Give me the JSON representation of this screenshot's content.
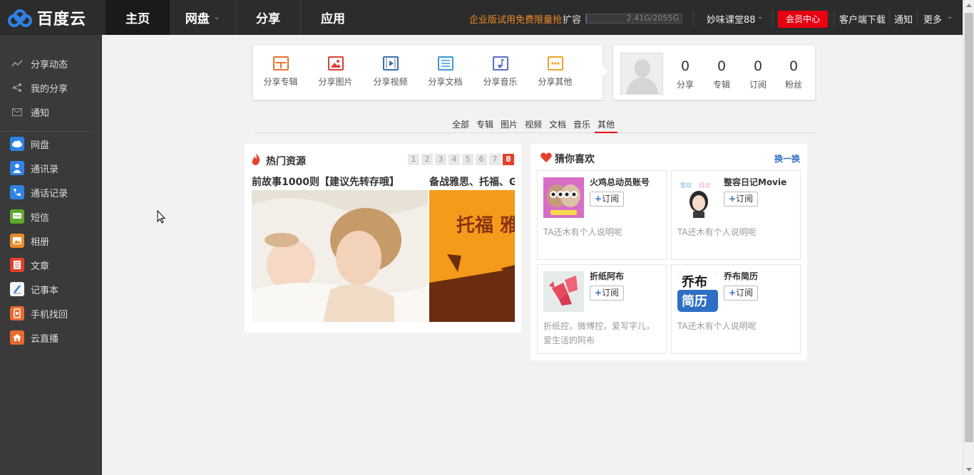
{
  "logo": {
    "text": "百度云",
    "brand_color": "#2e83e6"
  },
  "top_nav": [
    {
      "label": "主页",
      "active": true,
      "has_dropdown": false
    },
    {
      "label": "网盘",
      "active": false,
      "has_dropdown": true
    },
    {
      "label": "分享",
      "active": false,
      "has_dropdown": false
    },
    {
      "label": "应用",
      "active": false,
      "has_dropdown": false
    }
  ],
  "topbar": {
    "trial_text": "企业版试用免费限量抢",
    "expand_text": "扩容",
    "quota_text": "2.41G/2055G",
    "quota_used_fraction": 0.0012,
    "username": "妙味课堂88",
    "vip_button": "会员中心",
    "client_download": "客户端下载",
    "notify": "通知",
    "more": "更多",
    "accent_color": "#f08a24",
    "vip_color": "#e60012"
  },
  "sidebar": {
    "group1": [
      {
        "label": "分享动态",
        "icon": "activity-icon"
      },
      {
        "label": "我的分享",
        "icon": "share-icon"
      },
      {
        "label": "通知",
        "icon": "mail-icon"
      }
    ],
    "group2": [
      {
        "label": "网盘",
        "icon": "cloud-drive-icon",
        "color": "#2e83e6"
      },
      {
        "label": "通讯录",
        "icon": "contacts-icon",
        "color": "#2e83e6"
      },
      {
        "label": "通话记录",
        "icon": "call-log-icon",
        "color": "#2e83e6"
      },
      {
        "label": "短信",
        "icon": "sms-icon",
        "color": "#5fa92d"
      },
      {
        "label": "相册",
        "icon": "album-icon",
        "color": "#e88a2a"
      },
      {
        "label": "文章",
        "icon": "article-icon",
        "color": "#e3412c"
      },
      {
        "label": "记事本",
        "icon": "notepad-icon",
        "color": "#3a7bd5"
      },
      {
        "label": "手机找回",
        "icon": "phone-find-icon",
        "color": "#e96b2d"
      },
      {
        "label": "云直播",
        "icon": "live-icon",
        "color": "#e96b2d"
      }
    ]
  },
  "share_panel": [
    {
      "label": "分享专辑",
      "icon": "album-share-icon",
      "color": "#e8742a"
    },
    {
      "label": "分享图片",
      "icon": "image-share-icon",
      "color": "#d9423a"
    },
    {
      "label": "分享视频",
      "icon": "video-share-icon",
      "color": "#3a6fa8"
    },
    {
      "label": "分享文档",
      "icon": "doc-share-icon",
      "color": "#3a9ad9"
    },
    {
      "label": "分享音乐",
      "icon": "music-share-icon",
      "color": "#5a6ec8"
    },
    {
      "label": "分享其他",
      "icon": "other-share-icon",
      "color": "#f2a22a"
    }
  ],
  "profile": {
    "stats": [
      {
        "num": "0",
        "label": "分享"
      },
      {
        "num": "0",
        "label": "专辑"
      },
      {
        "num": "0",
        "label": "订阅"
      },
      {
        "num": "0",
        "label": "粉丝"
      }
    ]
  },
  "filter_tabs": [
    {
      "label": "全部",
      "active": false
    },
    {
      "label": "专辑",
      "active": false
    },
    {
      "label": "图片",
      "active": false
    },
    {
      "label": "视频",
      "active": false
    },
    {
      "label": "文档",
      "active": false
    },
    {
      "label": "音乐",
      "active": false
    },
    {
      "label": "其他",
      "active": true
    }
  ],
  "hot": {
    "title": "热门资源",
    "pages": [
      "1",
      "2",
      "3",
      "4",
      "5",
      "6",
      "7",
      "8"
    ],
    "active_page": "8",
    "slide1_title": "前故事1000则【建议先转存哦】",
    "slide2_title": "备战雅思、托福、G",
    "slide2_banner": "托福 雅"
  },
  "like": {
    "title": "猜你喜欢",
    "refresh": "换一换",
    "subscribe_label": "订阅",
    "items": [
      {
        "name": "火鸡总动员账号",
        "desc": "TA还木有个人说明呢",
        "thumb": "owls-thumb"
      },
      {
        "name": "整容日记Movie",
        "desc": "TA还木有个人说明呢",
        "thumb": "girl-thumb"
      },
      {
        "name": "折纸阿布",
        "desc": "折纸控，微博控，爱写字儿，爱生活的阿布",
        "thumb": "origami-thumb"
      },
      {
        "name": "乔布简历",
        "desc": "TA还木有个人说明呢",
        "thumb": "resume-thumb",
        "thumb_text1": "乔布",
        "thumb_text2": "简历"
      }
    ]
  }
}
